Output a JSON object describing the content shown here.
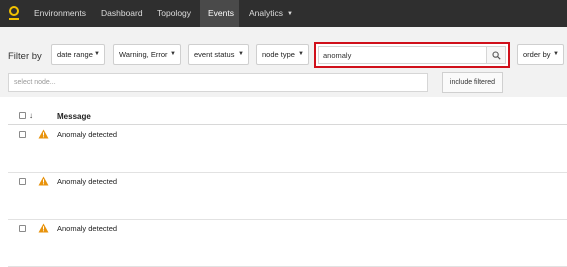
{
  "nav": {
    "items": [
      {
        "label": "Environments"
      },
      {
        "label": "Dashboard"
      },
      {
        "label": "Topology"
      },
      {
        "label": "Events"
      },
      {
        "label": "Analytics"
      }
    ],
    "active": "Events",
    "logo_icon": "location-pin-icon"
  },
  "filters": {
    "label": "Filter by",
    "date_range": "date range",
    "severity": "Warning, Error",
    "event_status": "event status",
    "node_type": "node type",
    "search_value": "anomaly",
    "order_by": "order by",
    "node_placeholder": "select node...",
    "include_filtered": "include filtered"
  },
  "table": {
    "message_header": "Message",
    "sort_icon": "sort-down-icon",
    "rows": [
      {
        "message": "Anomaly detected",
        "severity_icon": "warning-icon"
      },
      {
        "message": "Anomaly detected",
        "severity_icon": "warning-icon"
      },
      {
        "message": "Anomaly detected",
        "severity_icon": "warning-icon"
      }
    ]
  },
  "colors": {
    "navbar": "#2f2f2f",
    "nav_active": "#4a4a4a",
    "highlight": "#d0101b",
    "warning": "#e8930c",
    "logo": "#f2c200"
  }
}
